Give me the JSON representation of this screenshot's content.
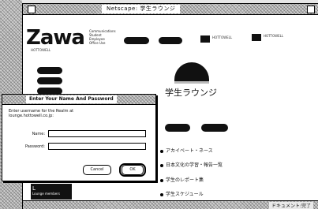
{
  "window": {
    "title": "Netscape: 学生ラウンジ"
  },
  "logo": {
    "text": "Zawa",
    "tagline": "HOTTOWELL"
  },
  "top_links": [
    "Communications",
    "Student",
    "Employee",
    "Office Use"
  ],
  "nav_pills": [
    "",
    ""
  ],
  "chips": [
    {
      "text": "HOTTOWELL"
    },
    {
      "text": "HOTTOWELL"
    }
  ],
  "side_nav": [
    "",
    "",
    ""
  ],
  "page": {
    "heading": "学生ラウンジ",
    "tab_buttons": [
      "",
      ""
    ],
    "menu": [
      "アカイベート・ネース",
      "日本文化の学習・報告一覧",
      "学生のレポート集",
      "学生スケジュール"
    ]
  },
  "dialog": {
    "title": "Enter Your Name And Password",
    "prompt": "Enter username for the Realm at lounge.hottowell.co.jp:",
    "name_label": "Name:",
    "name_value": "",
    "password_label": "Password:",
    "password_value": "",
    "cancel_label": "Cancel",
    "ok_label": "OK"
  },
  "photo_strip": {
    "letter": "L",
    "caption": "Lounge members"
  },
  "status": {
    "text": "ドキュメント:完了"
  }
}
